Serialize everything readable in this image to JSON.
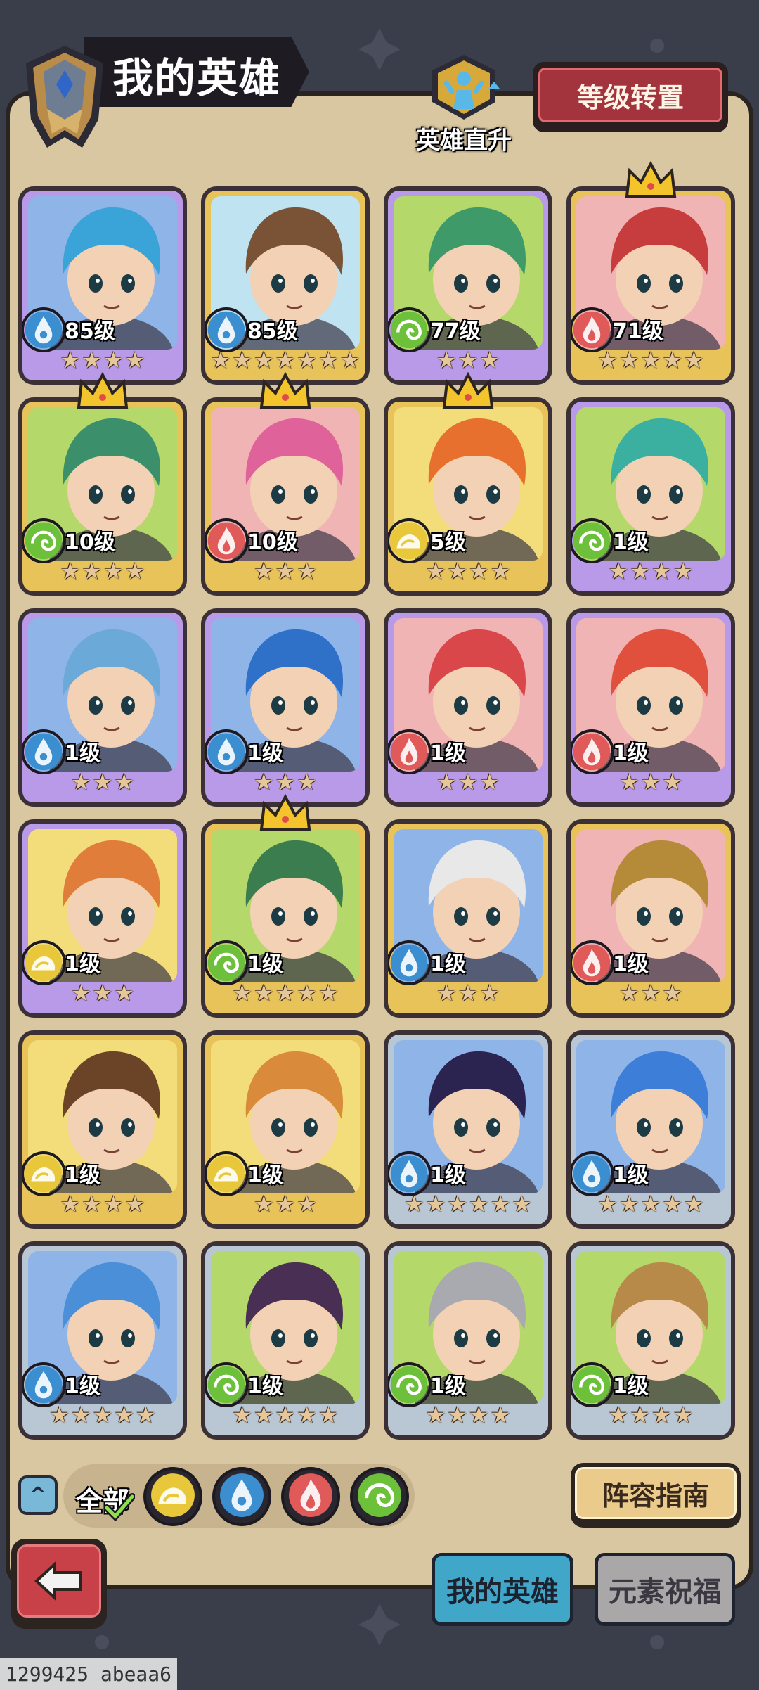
{
  "header": {
    "title": "我的英雄",
    "direct_upgrade_label": "英雄直升",
    "level_reset_label": "等级转置"
  },
  "heroes": [
    {
      "level": "85级",
      "element": "water",
      "stars": 4,
      "frame": "purple",
      "crown": false,
      "bg": "#8fb4e8",
      "hair": "#3aa3d8"
    },
    {
      "level": "85级",
      "element": "water",
      "stars": 7,
      "frame": "gold",
      "crown": false,
      "bg": "#bfe3f0",
      "hair": "#7a5236"
    },
    {
      "level": "77级",
      "element": "wood",
      "stars": 3,
      "frame": "purple",
      "crown": false,
      "bg": "#b5d86a",
      "hair": "#3f9a6a"
    },
    {
      "level": "71级",
      "element": "fire",
      "stars": 5,
      "frame": "gold",
      "crown": true,
      "bg": "#f0b4b4",
      "hair": "#c73d3d"
    },
    {
      "level": "10级",
      "element": "wood",
      "stars": 4,
      "frame": "gold",
      "crown": true,
      "bg": "#b5d86a",
      "hair": "#3b8f6b"
    },
    {
      "level": "10级",
      "element": "fire",
      "stars": 3,
      "frame": "gold",
      "crown": true,
      "bg": "#f0b4b4",
      "hair": "#e0629a"
    },
    {
      "level": "5级",
      "element": "earth",
      "stars": 4,
      "frame": "gold",
      "crown": true,
      "bg": "#f2dd7a",
      "hair": "#e8702f"
    },
    {
      "level": "1级",
      "element": "wood",
      "stars": 4,
      "frame": "purple",
      "crown": false,
      "bg": "#b5d86a",
      "hair": "#3bb0a0"
    },
    {
      "level": "1级",
      "element": "water",
      "stars": 3,
      "frame": "purple",
      "crown": false,
      "bg": "#8fb4e8",
      "hair": "#6aa9d8"
    },
    {
      "level": "1级",
      "element": "water",
      "stars": 3,
      "frame": "purple",
      "crown": false,
      "bg": "#8fb4e8",
      "hair": "#2f70c8"
    },
    {
      "level": "1级",
      "element": "fire",
      "stars": 3,
      "frame": "purple",
      "crown": false,
      "bg": "#f0b4b4",
      "hair": "#d9474b"
    },
    {
      "level": "1级",
      "element": "fire",
      "stars": 3,
      "frame": "purple",
      "crown": false,
      "bg": "#f0b4b4",
      "hair": "#e0503c"
    },
    {
      "level": "1级",
      "element": "earth",
      "stars": 3,
      "frame": "purple",
      "crown": false,
      "bg": "#f2dd7a",
      "hair": "#e07d3a"
    },
    {
      "level": "1级",
      "element": "wood",
      "stars": 5,
      "frame": "gold",
      "crown": true,
      "bg": "#b5d86a",
      "hair": "#3b7d4e"
    },
    {
      "level": "1级",
      "element": "water",
      "stars": 3,
      "frame": "gold",
      "crown": false,
      "bg": "#8fb4e8",
      "hair": "#e8e8e8"
    },
    {
      "level": "1级",
      "element": "fire",
      "stars": 3,
      "frame": "gold",
      "crown": false,
      "bg": "#f0b4b4",
      "hair": "#b58a38"
    },
    {
      "level": "1级",
      "element": "earth",
      "stars": 4,
      "frame": "gold",
      "crown": false,
      "bg": "#f2dd7a",
      "hair": "#6b4428"
    },
    {
      "level": "1级",
      "element": "earth",
      "stars": 3,
      "frame": "gold",
      "crown": false,
      "bg": "#f2dd7a",
      "hair": "#d98a3a"
    },
    {
      "level": "1级",
      "element": "water",
      "stars": 6,
      "frame": "silver",
      "crown": false,
      "bg": "#8fb4e8",
      "hair": "#2b2450"
    },
    {
      "level": "1级",
      "element": "water",
      "stars": 5,
      "frame": "silver",
      "crown": false,
      "bg": "#8fb4e8",
      "hair": "#3d7fd8"
    },
    {
      "level": "1级",
      "element": "water",
      "stars": 5,
      "frame": "silver",
      "crown": false,
      "bg": "#8fb4e8",
      "hair": "#4a8fd8"
    },
    {
      "level": "1级",
      "element": "wood",
      "stars": 5,
      "frame": "silver",
      "crown": false,
      "bg": "#b5d86a",
      "hair": "#4a2f55"
    },
    {
      "level": "1级",
      "element": "wood",
      "stars": 4,
      "frame": "silver",
      "crown": false,
      "bg": "#b5d86a",
      "hair": "#a8aab0"
    },
    {
      "level": "1级",
      "element": "wood",
      "stars": 4,
      "frame": "silver",
      "crown": false,
      "bg": "#b5d86a",
      "hair": "#b88a4a"
    }
  ],
  "filter": {
    "all_label": "全部",
    "elements": [
      "earth-icon",
      "water-icon",
      "fire-icon",
      "wood-icon"
    ]
  },
  "lineup_guide_label": "阵容指南",
  "tabs": {
    "my_heroes": "我的英雄",
    "element_blessing": "元素祝福"
  },
  "watermark": "1299425 abeaa6",
  "colors": {
    "panel": "#d9c7a1",
    "water": "#3b8fd0",
    "wood": "#6cc03a",
    "fire": "#e05a5a",
    "earth": "#e8c83a",
    "frame_gold": "#e7c35a",
    "frame_purple": "#b89ae8",
    "frame_silver": "#b9c6d4"
  }
}
